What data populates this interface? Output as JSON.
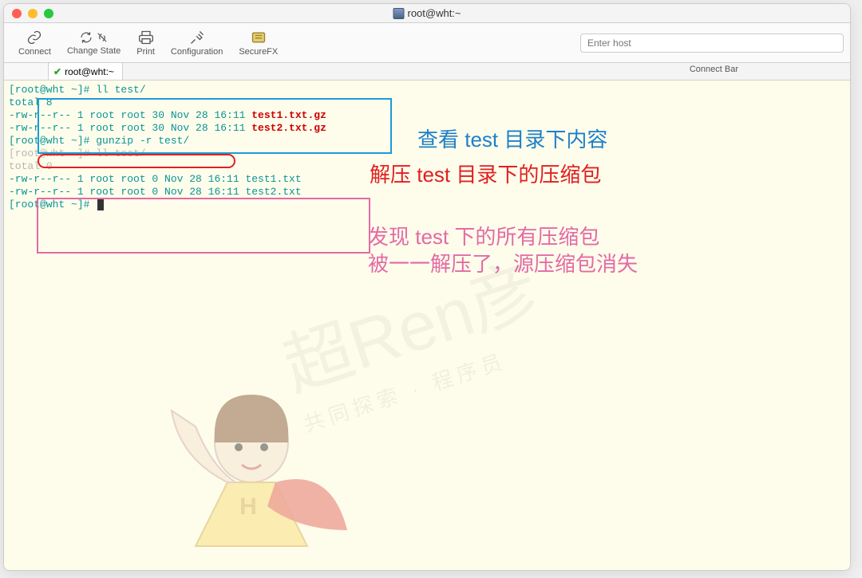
{
  "window": {
    "title": "root@wht:~"
  },
  "toolbar": {
    "connect": "Connect",
    "change_state": "Change State",
    "print": "Print",
    "configuration": "Configuration",
    "securefx": "SecureFX",
    "host_placeholder": "Enter host",
    "connect_bar": "Connect Bar"
  },
  "tab": {
    "label": "root@wht:~"
  },
  "terminal": {
    "l1": "[root@wht ~]# ll test/",
    "l2": "total 8",
    "l3a": "-rw-r--r-- 1 root root 30 Nov 28 16:11 ",
    "l3b": "test1.txt.gz",
    "l4a": "-rw-r--r-- 1 root root 30 Nov 28 16:11 ",
    "l4b": "test2.txt.gz",
    "l5": "[root@wht ~]# gunzip -r test/",
    "l6": "[root@wht ~]# ll test/",
    "l7": "total 0",
    "l8": "-rw-r--r-- 1 root root 0 Nov 28 16:11 test1.txt",
    "l9": "-rw-r--r-- 1 root root 0 Nov 28 16:11 test2.txt",
    "l10": "[root@wht ~]# "
  },
  "annotations": {
    "blue": "查看 test 目录下内容",
    "red": "解压 test 目录下的压缩包",
    "pink_l1": "发现 test 下的所有压缩包",
    "pink_l2": "被一一解压了，源压缩包消失"
  },
  "watermark": {
    "big": "超Ren彦",
    "small": "共同探索 · 程序员"
  }
}
